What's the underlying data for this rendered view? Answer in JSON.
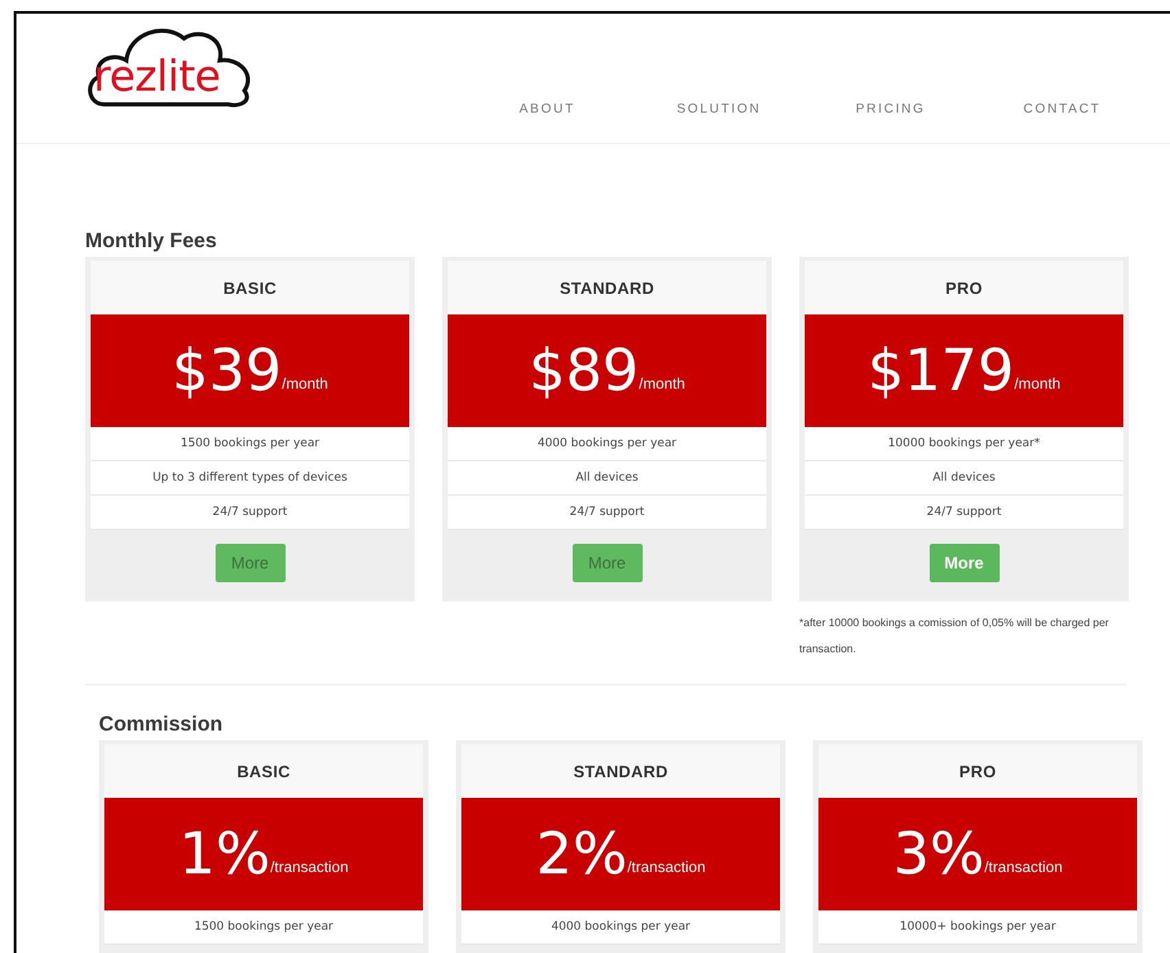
{
  "logo": {
    "text": "rezlite"
  },
  "nav": [
    {
      "label": "ABOUT"
    },
    {
      "label": "SOLUTION"
    },
    {
      "label": "PRICING"
    },
    {
      "label": "CONTACT"
    }
  ],
  "sections": [
    {
      "title": "Monthly Fees",
      "plans": [
        {
          "name": "BASIC",
          "price": "$39",
          "unit": "/month",
          "features": [
            "1500 bookings per year",
            "Up to 3 different types of devices",
            "24/7 support"
          ],
          "button": {
            "label": "More",
            "highlighted": false
          }
        },
        {
          "name": "STANDARD",
          "price": "$89",
          "unit": "/month",
          "features": [
            "4000 bookings per year",
            "All devices",
            "24/7 support"
          ],
          "button": {
            "label": "More",
            "highlighted": false
          }
        },
        {
          "name": "PRO",
          "price": "$179",
          "unit": "/month",
          "features": [
            "10000 bookings per year*",
            "All devices",
            "24/7 support"
          ],
          "button": {
            "label": "More",
            "highlighted": true
          },
          "footnote": "*after 10000 bookings a comission of 0,05% will be charged per transaction."
        }
      ]
    },
    {
      "title": "Commission",
      "plans": [
        {
          "name": "BASIC",
          "price": "1%",
          "unit": "/transaction",
          "features": [
            "1500 bookings per year"
          ]
        },
        {
          "name": "STANDARD",
          "price": "2%",
          "unit": "/transaction",
          "features": [
            "4000 bookings per year"
          ]
        },
        {
          "name": "PRO",
          "price": "3%",
          "unit": "/transaction",
          "features": [
            "10000+ bookings per year"
          ]
        }
      ]
    }
  ]
}
